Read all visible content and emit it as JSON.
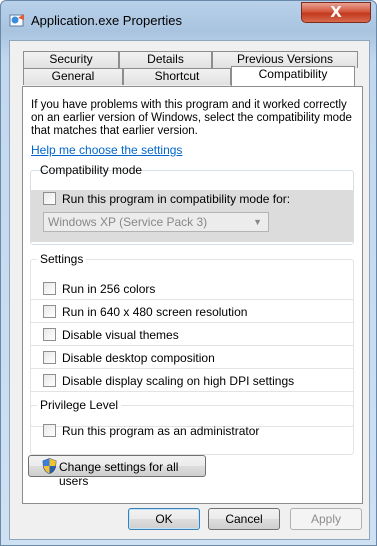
{
  "window": {
    "title": "Application.exe Properties",
    "close_glyph": "X"
  },
  "tabs": {
    "row1": [
      "Security",
      "Details",
      "Previous Versions"
    ],
    "row2": [
      "General",
      "Shortcut",
      "Compatibility"
    ],
    "active": "Compatibility"
  },
  "intro": {
    "text": "If you have problems with this program and it worked correctly on an earlier version of Windows, select the compatibility mode that matches that earlier version.",
    "help_link": "Help me choose the settings"
  },
  "compat_mode": {
    "title": "Compatibility mode",
    "checkbox_label": "Run this program in compatibility mode for:",
    "checked": false,
    "select_value": "Windows XP (Service Pack 3)"
  },
  "settings": {
    "title": "Settings",
    "items": [
      {
        "label": "Run in 256 colors",
        "checked": false
      },
      {
        "label": "Run in 640 x 480 screen resolution",
        "checked": false
      },
      {
        "label": "Disable visual themes",
        "checked": false
      },
      {
        "label": "Disable desktop composition",
        "checked": false
      },
      {
        "label": "Disable display scaling on high DPI settings",
        "checked": false
      }
    ]
  },
  "privilege": {
    "title": "Privilege Level",
    "item": {
      "label": "Run this program as an administrator",
      "checked": false
    }
  },
  "change_button": {
    "label": "Change settings for all users"
  },
  "buttons": {
    "ok": "OK",
    "cancel": "Cancel",
    "apply": "Apply"
  },
  "colors": {
    "link": "#0066cc",
    "close_red": "#c2391d",
    "title_bar": "#b9d1ea"
  }
}
